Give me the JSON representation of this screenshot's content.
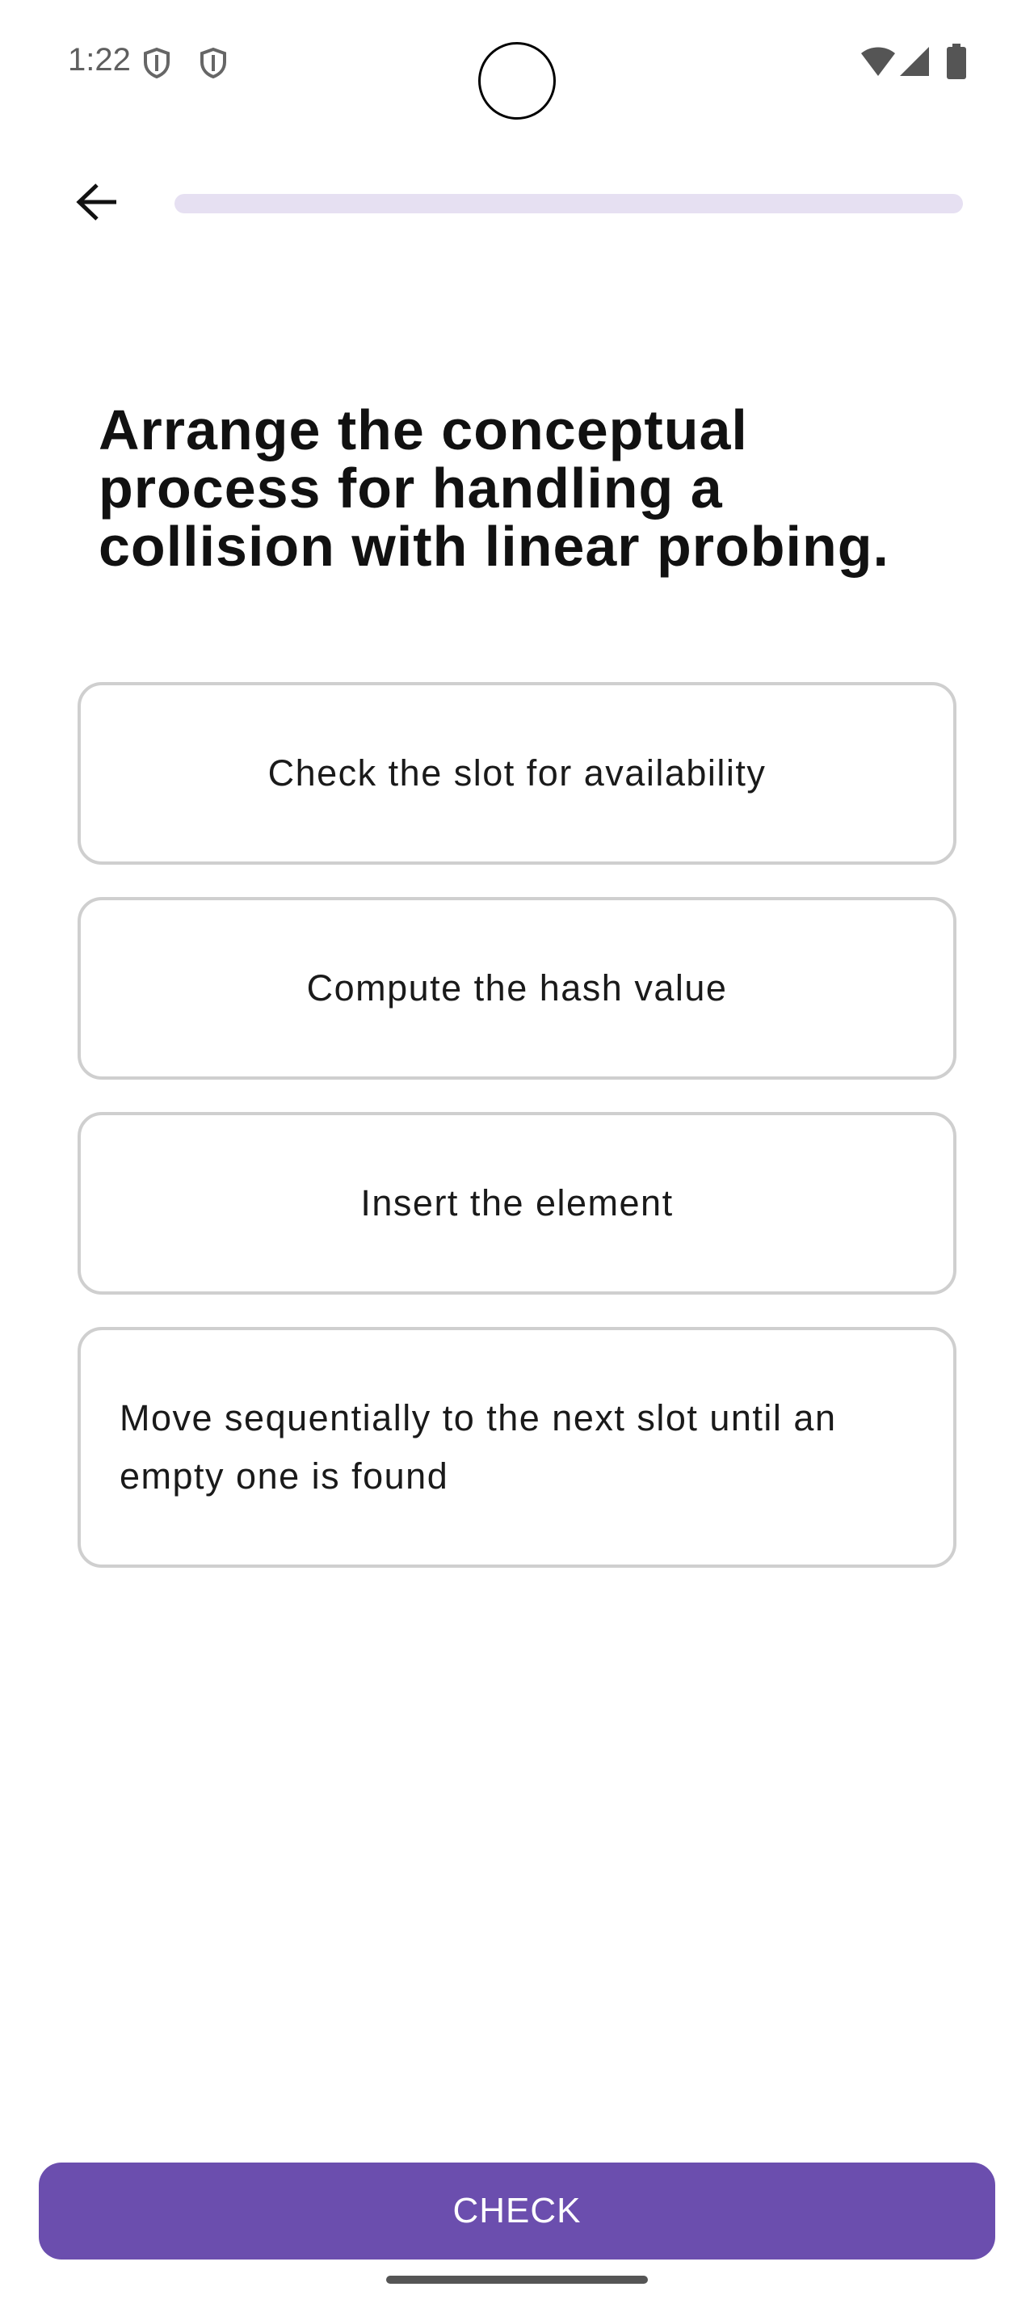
{
  "status_bar": {
    "time": "1:22",
    "icons": [
      "shield-icon",
      "shield-icon",
      "wifi-icon",
      "signal-icon",
      "battery-icon"
    ]
  },
  "nav": {
    "back_icon": "arrow-left-icon",
    "progress_fraction": 0.0
  },
  "question": {
    "text": "Arrange the conceptual process for handling a collision with linear probing."
  },
  "options": [
    {
      "label": "Check the slot for availability"
    },
    {
      "label": "Compute the hash value"
    },
    {
      "label": "Insert the element"
    },
    {
      "label": "Move sequentially to the next slot until an empty one is found"
    }
  ],
  "actions": {
    "check_label": "CHECK"
  },
  "colors": {
    "accent": "#6b4eae",
    "progress_track": "#e6e0f2",
    "card_border": "#cfcfcf"
  }
}
